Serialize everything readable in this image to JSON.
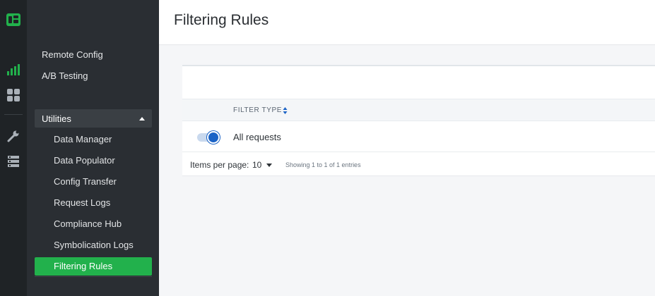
{
  "page": {
    "title": "Filtering Rules"
  },
  "rail": {
    "icons": [
      "app-logo-icon",
      "analytics-icon",
      "dashboard-grid-icon",
      "wrench-icon",
      "server-icon"
    ],
    "accent": "#22b14c"
  },
  "sidebar": {
    "items": [
      {
        "label": "Remote Config"
      },
      {
        "label": "A/B Testing"
      }
    ],
    "section": {
      "label": "Utilities",
      "items": [
        {
          "label": "Data Manager"
        },
        {
          "label": "Data Populator"
        },
        {
          "label": "Config Transfer"
        },
        {
          "label": "Request Logs"
        },
        {
          "label": "Compliance Hub"
        },
        {
          "label": "Symbolication Logs"
        },
        {
          "label": "Filtering Rules",
          "active": true
        }
      ]
    }
  },
  "table": {
    "columns": [
      "FILTER TYPE"
    ],
    "rows": [
      {
        "enabled": true,
        "filter_type": "All requests"
      }
    ],
    "footer": {
      "items_per_page_label": "Items per page:",
      "items_per_page_value": "10",
      "showing": "Showing 1 to 1 of 1 entries"
    }
  }
}
